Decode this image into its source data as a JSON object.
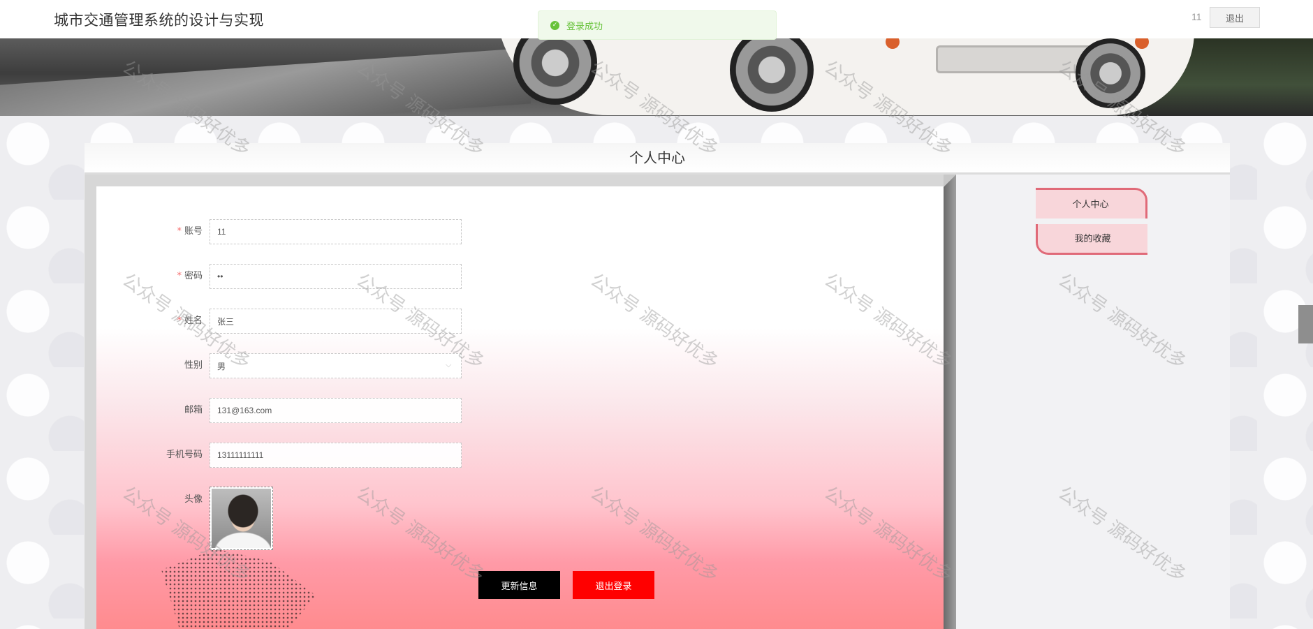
{
  "header": {
    "site_title": "城市交通管理系统的设计与实现",
    "username": "11",
    "logout_label": "退出"
  },
  "toast": {
    "message": "登录成功",
    "icon": "check-circle-icon",
    "color": "#67c23a"
  },
  "panel": {
    "title": "个人中心"
  },
  "form": {
    "account": {
      "label": "账号",
      "value": "11",
      "required": true
    },
    "password": {
      "label": "密码",
      "value": "••",
      "required": true
    },
    "name": {
      "label": "姓名",
      "value": "张三",
      "required": true
    },
    "gender": {
      "label": "性别",
      "value": "男"
    },
    "email": {
      "label": "邮箱",
      "value": "131@163.com"
    },
    "phone": {
      "label": "手机号码",
      "value": "13111111111"
    },
    "avatar": {
      "label": "头像"
    },
    "required_mark": "*"
  },
  "buttons": {
    "update": "更新信息",
    "logout": "退出登录"
  },
  "sidebar": {
    "items": [
      {
        "label": "个人中心"
      },
      {
        "label": "我的收藏"
      }
    ],
    "accent": "#e06a78"
  },
  "watermark": "公众号 源码好优多",
  "colors": {
    "update_button": "#000000",
    "logout_button": "#ff0000"
  }
}
